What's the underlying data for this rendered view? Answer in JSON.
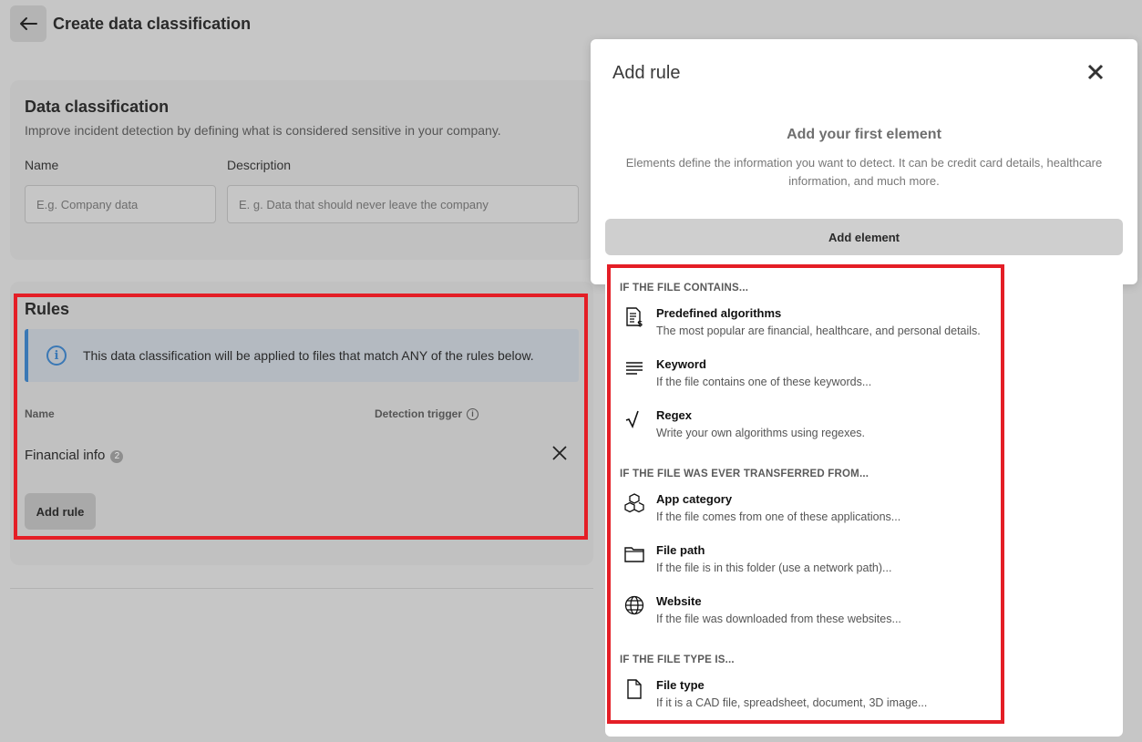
{
  "page": {
    "title": "Create data classification"
  },
  "data_classification": {
    "title": "Data classification",
    "subtitle": "Improve incident detection by defining what is considered sensitive in your company.",
    "name_label": "Name",
    "name_placeholder": "E.g. Company data",
    "description_label": "Description",
    "description_placeholder": "E. g. Data that should never leave the company"
  },
  "rules": {
    "title": "Rules",
    "info_text": "This data classification will be applied to files that match ANY of the rules below.",
    "col_name": "Name",
    "col_trigger": "Detection trigger",
    "row_name": "Financial info",
    "row_badge": "2",
    "add_rule_label": "Add rule"
  },
  "modal": {
    "title": "Add rule",
    "close_glyph": "✕",
    "empty_title": "Add your first element",
    "empty_desc": "Elements define the information you want to detect. It can be credit card details, healthcare information, and much more.",
    "add_element_label": "Add element"
  },
  "menu": {
    "sections": [
      {
        "title": "IF THE FILE CONTAINS...",
        "options": [
          {
            "title": "Predefined algorithms",
            "desc": "The most popular are financial, healthcare, and personal details.",
            "icon": "document-dollar-icon"
          },
          {
            "title": "Keyword",
            "desc": "If the file contains one of these keywords...",
            "icon": "text-lines-icon"
          },
          {
            "title": "Regex",
            "desc": "Write your own algorithms using regexes.",
            "icon": "square-root-icon"
          }
        ]
      },
      {
        "title": "IF THE FILE WAS EVER TRANSFERRED FROM...",
        "options": [
          {
            "title": "App category",
            "desc": "If the file comes from one of these applications...",
            "icon": "cubes-icon"
          },
          {
            "title": "File path",
            "desc": "If the file is in this folder (use a network path)...",
            "icon": "folder-icon"
          },
          {
            "title": "Website",
            "desc": "If the file was downloaded from these websites...",
            "icon": "globe-icon"
          }
        ]
      },
      {
        "title": "IF THE FILE TYPE IS...",
        "options": [
          {
            "title": "File type",
            "desc": "If it is a CAD file, spreadsheet, document, 3D image...",
            "icon": "file-icon"
          }
        ]
      }
    ]
  },
  "colors": {
    "overlay": "#c6c6c6",
    "highlight": "#e41e26",
    "info_accent": "#3a78b5"
  }
}
